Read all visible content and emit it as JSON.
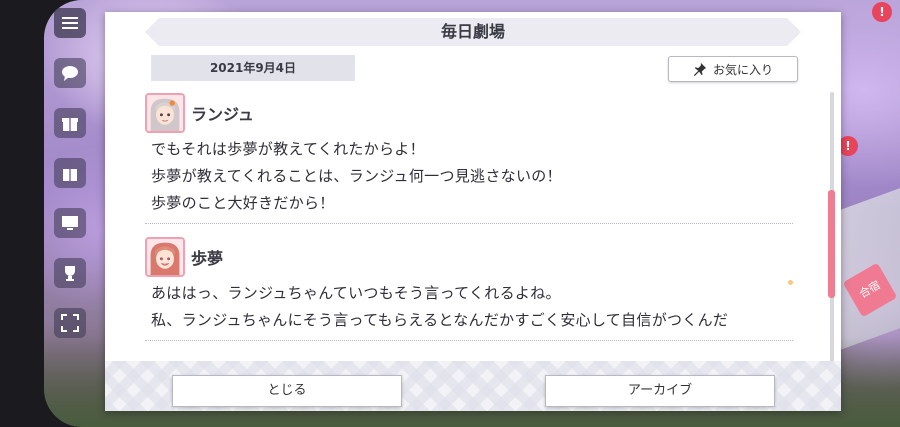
{
  "dialog": {
    "title": "毎日劇場",
    "date": "2021年9月4日",
    "favorite_label": "お気に入り",
    "entries": [
      {
        "speaker": "ランジュ",
        "lines": [
          "でもそれは歩夢が教えてくれたからよ！",
          "歩夢が教えてくれることは、ランジュ何一つ見逃さないの！",
          "歩夢のこと大好きだから！"
        ]
      },
      {
        "speaker": "歩夢",
        "lines": [
          "あははっ、ランジュちゃんていつもそう言ってくれるよね。",
          "私、ランジュちゃんにそう言ってもらえるとなんだかすごく安心して自信がつくんだ"
        ]
      }
    ],
    "close_label": "とじる",
    "archive_label": "アーカイブ"
  },
  "background": {
    "badge_top": "!",
    "badge_side": "!",
    "side_label": "合宿"
  },
  "colors": {
    "accent": "#ef7d92",
    "title_bg": "#ebebf1",
    "date_bg": "#e2e2ea"
  },
  "icons": {
    "favorite": "pin-icon",
    "menu": "hamburger-icon"
  }
}
